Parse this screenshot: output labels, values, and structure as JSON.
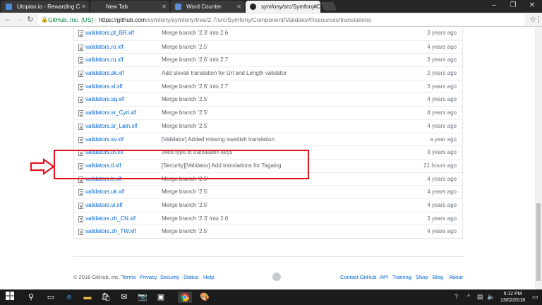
{
  "browser": {
    "tabs": [
      {
        "title": "Utopian.io - Rewarding C",
        "favicon_color": "#4c8ad8"
      },
      {
        "title": "New Tab",
        "favicon_color": ""
      },
      {
        "title": "Word Counter",
        "favicon_color": "#5a8fd8"
      },
      {
        "title": "symfony/src/Symfony/C",
        "favicon_color": "#eee"
      }
    ],
    "address": {
      "org": "GitHub, Inc. [US]",
      "host": "https://github.com",
      "path": "/symfony/symfony/tree/2.7/src/Symfony/Component/Validator/Resources/translations"
    }
  },
  "files": [
    {
      "name": "validators.pt_BR.xlf",
      "message": "Merge branch '2.3' into 2.6",
      "age": "3 years ago"
    },
    {
      "name": "validators.ro.xlf",
      "message": "Merge branch '2.5'",
      "age": "4 years ago"
    },
    {
      "name": "validators.ru.xlf",
      "message": "Merge branch '2.6' into 2.7",
      "age": "3 years ago"
    },
    {
      "name": "validators.sk.xlf",
      "message": "Add slovak translation for Url and Length validator",
      "age": "2 years ago"
    },
    {
      "name": "validators.sl.xlf",
      "message": "Merge branch '2.6' into 2.7",
      "age": "3 years ago"
    },
    {
      "name": "validators.sq.xlf",
      "message": "Merge branch '2.5'",
      "age": "4 years ago"
    },
    {
      "name": "validators.sr_Cyrl.xlf",
      "message": "Merge branch '2.5'",
      "age": "4 years ago"
    },
    {
      "name": "validators.sr_Latn.xlf",
      "message": "Merge branch '2.5'",
      "age": "4 years ago"
    },
    {
      "name": "validators.sv.xlf",
      "message": "[Validator] Added missing swedish translation",
      "age": "a year ago"
    },
    {
      "name": "validators.th.xlf",
      "message": "fixed typo in translation keys",
      "age": "3 years ago"
    },
    {
      "name": "validators.tl.xlf",
      "message": "[Security][Validator] Add translations for Tagalog",
      "age": "21 hours ago"
    },
    {
      "name": "validators.tr.xlf",
      "message": "Merge branch '2.5'",
      "age": "4 years ago"
    },
    {
      "name": "validators.uk.xlf",
      "message": "Merge branch '2.5'",
      "age": "4 years ago"
    },
    {
      "name": "validators.vi.xlf",
      "message": "Merge branch '2.5'",
      "age": "4 years ago"
    },
    {
      "name": "validators.zh_CN.xlf",
      "message": "Merge branch '2.3' into 2.6",
      "age": "3 years ago"
    },
    {
      "name": "validators.zh_TW.xlf",
      "message": "Merge branch '2.5'",
      "age": "4 years ago"
    }
  ],
  "footer": {
    "copyright": "© 2018 GitHub, Inc.",
    "left_links": [
      "Terms",
      "Privacy",
      "Security",
      "Status",
      "Help"
    ],
    "right_links": [
      "Contact GitHub",
      "API",
      "Training",
      "Shop",
      "Blog",
      "About"
    ]
  },
  "taskbar": {
    "time": "5:12 PM",
    "date": "13/02/2018"
  },
  "colors": {
    "highlight": "#e0141f",
    "link": "#0366d6"
  }
}
